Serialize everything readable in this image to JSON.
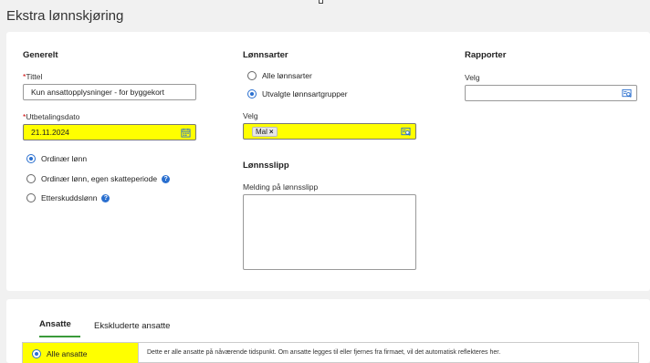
{
  "page": {
    "title": "Ekstra lønnskjøring"
  },
  "general": {
    "heading": "Generelt",
    "title_required": "*",
    "title_label": "Tittel",
    "title_value": "Kun ansattopplysninger - for byggekort",
    "date_required": "*",
    "date_label": "Utbetalingsdato",
    "date_value": "21.11.2024",
    "pay_options": [
      {
        "label": "Ordinær lønn",
        "selected": true,
        "help": false
      },
      {
        "label": "Ordinær lønn, egen skatteperiode",
        "selected": false,
        "help": true
      },
      {
        "label": "Etterskuddslønn",
        "selected": false,
        "help": true
      }
    ]
  },
  "wage_types": {
    "heading": "Lønnsarter",
    "options": [
      {
        "label": "Alle lønnsarter",
        "selected": false
      },
      {
        "label": "Utvalgte lønnsartgrupper",
        "selected": true
      }
    ],
    "select_label": "Velg",
    "chips": [
      {
        "label": "Mal"
      }
    ],
    "chip_remove": "×"
  },
  "payslip": {
    "heading": "Lønnsslipp",
    "message_label": "Melding på lønnsslipp",
    "message_value": ""
  },
  "reports": {
    "heading": "Rapporter",
    "select_label": "Velg",
    "select_value": ""
  },
  "employees": {
    "tabs": [
      {
        "label": "Ansatte",
        "active": true
      },
      {
        "label": "Ekskluderte ansatte",
        "active": false
      }
    ],
    "selection_label": "Alle ansatte",
    "selection_selected": true,
    "info": "Dette er alle ansatte på nåværende tidspunkt. Om ansatte legges til eller fjernes fra firmaet, vil det automatisk reflekteres her."
  },
  "help_glyph": "?",
  "colors": {
    "accent": "#2a6fcf",
    "highlight": "#ffff00",
    "tab_active": "#3a9a3a"
  }
}
